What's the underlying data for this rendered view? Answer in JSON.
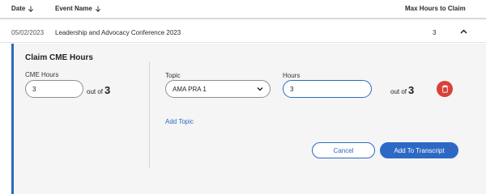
{
  "table": {
    "headers": {
      "date": "Date",
      "event_name": "Event Name",
      "max_hours": "Max Hours to Claim"
    },
    "row": {
      "date": "05/02/2023",
      "event_name": "Leadership and Advocacy Conference 2023",
      "max_hours": "3"
    }
  },
  "claim_panel": {
    "title": "Claim CME Hours",
    "cme_hours_label": "CME Hours",
    "cme_hours_value": "3",
    "out_of_label": "out of",
    "out_of_value": "3",
    "topic_label": "Topic",
    "topic_selected": "AMA PRA 1",
    "hours_label": "Hours",
    "hours_value": "3",
    "topic_out_of_label": "out of",
    "topic_out_of_value": "3",
    "add_topic_label": "Add Topic",
    "cancel_label": "Cancel",
    "submit_label": "Add To Transcript"
  },
  "colors": {
    "accent": "#2d69c4",
    "danger": "#d9413b",
    "panel_bg": "#f5f5f5"
  },
  "icons": {
    "sort": "arrow-down-icon",
    "collapse": "chevron-up-icon",
    "dropdown": "chevron-down-icon",
    "delete": "trash-icon"
  }
}
